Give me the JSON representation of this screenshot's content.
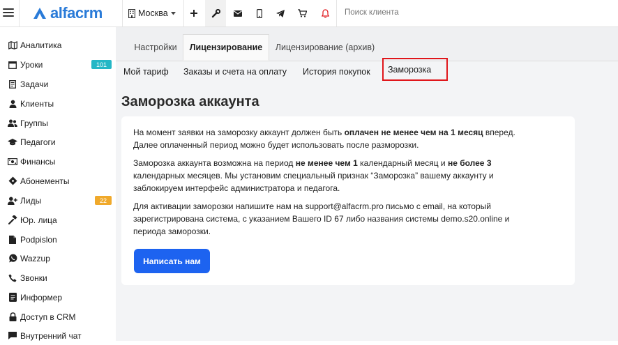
{
  "header": {
    "logo_text": "alfacrm",
    "city": "Москва",
    "search_placeholder": "Поиск клиента",
    "icons": [
      "menu-icon",
      "building-icon",
      "plus-icon",
      "wrench-icon",
      "mail-icon",
      "phone-icon",
      "telegram-icon",
      "cart-icon",
      "bell-icon"
    ],
    "accent": "#2a7bd8",
    "bell_color": "#e0161b"
  },
  "sidebar": {
    "items": [
      {
        "label": "Аналитика",
        "icon": "map-icon"
      },
      {
        "label": "Уроки",
        "icon": "calendar-icon",
        "badge": "101",
        "badge_color": "#25b7c6"
      },
      {
        "label": "Задачи",
        "icon": "tasks-icon"
      },
      {
        "label": "Клиенты",
        "icon": "user-icon"
      },
      {
        "label": "Группы",
        "icon": "users-icon"
      },
      {
        "label": "Педагоги",
        "icon": "graduation-cap-icon"
      },
      {
        "label": "Финансы",
        "icon": "money-icon"
      },
      {
        "label": "Абонементы",
        "icon": "ticket-icon"
      },
      {
        "label": "Лиды",
        "icon": "user-plus-icon",
        "badge": "22",
        "badge_color": "#f0a92b"
      },
      {
        "label": "Юр. лица",
        "icon": "hammer-icon"
      },
      {
        "label": "Podpislon",
        "icon": "document-icon"
      },
      {
        "label": "Wazzup",
        "icon": "whatsapp-icon"
      },
      {
        "label": "Звонки",
        "icon": "phone-call-icon"
      },
      {
        "label": "Информер",
        "icon": "informer-icon"
      },
      {
        "label": "Доступ в CRM",
        "icon": "lock-icon"
      },
      {
        "label": "Внутренний чат",
        "icon": "chat-icon"
      }
    ]
  },
  "tabs": [
    "Настройки",
    "Лицензирование",
    "Лицензирование (архив)"
  ],
  "active_tab": "Лицензирование",
  "subtabs": [
    "Мой тариф",
    "Заказы и счета на оплату",
    "История покупок",
    "Заморозка"
  ],
  "highlighted_subtab": "Заморозка",
  "highlight_color": "#e0161b",
  "page": {
    "title": "Заморозка аккаунта",
    "p1": {
      "a": "На момент заявки на заморозку аккаунт должен быть ",
      "b": "оплачен не менее чем на 1 месяц",
      "c": " вперед.",
      "d": "Далее оплаченный период можно будет использовать после разморозки."
    },
    "p2": {
      "a": "Заморозка аккаунта возможна на период ",
      "b": "не менее чем 1",
      "c": " календарный месяц и ",
      "d": "не более 3",
      "e": "календарных месяцев. Мы установим специальный признак “Заморозка” вашему аккаунту и",
      "f": "заблокируем интерфейс администратора и педагога."
    },
    "p3": {
      "a": "Для активации заморозки напишите нам на support@alfacrm.pro письмо с email, на который",
      "b": "зарегистрирована система, с указанием Вашего ID 67 либо названия системы demo.s20.online и",
      "c": "периода заморозки."
    },
    "button": "Написать нам",
    "button_color": "#1d63f0"
  }
}
